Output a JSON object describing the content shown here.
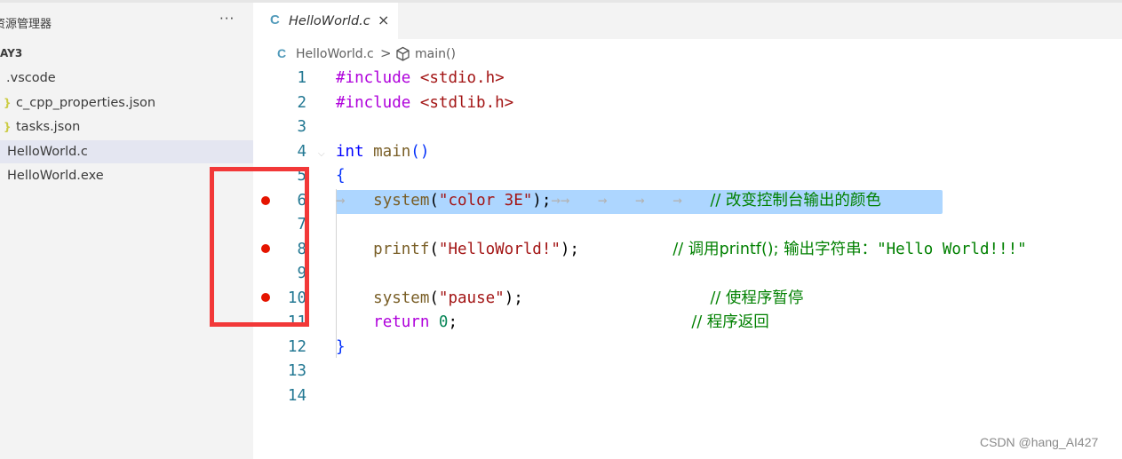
{
  "sidebar": {
    "title": "资源管理器",
    "more": "···",
    "project": "AY3",
    "items": [
      {
        "label": ".vscode",
        "icon": ""
      },
      {
        "label": "c_cpp_properties.json",
        "icon": "}"
      },
      {
        "label": "tasks.json",
        "icon": "}"
      },
      {
        "label": "HelloWorld.c",
        "icon": ""
      },
      {
        "label": "HelloWorld.exe",
        "icon": ""
      }
    ]
  },
  "editor": {
    "tab": {
      "icon": "C",
      "label": "HelloWorld.c",
      "close": "×"
    },
    "breadcrumb": {
      "icon": "C",
      "file": "HelloWorld.c",
      "sep": ">",
      "method_icon": "⬡",
      "method": "main()"
    },
    "line_numbers": [
      "1",
      "2",
      "3",
      "4",
      "5",
      "6",
      "7",
      "8",
      "9",
      "10",
      "11",
      "12",
      "13",
      "14"
    ],
    "code": {
      "l1_pp": "#include",
      "l1_hdr": " <stdio.h>",
      "l2_pp": "#include",
      "l2_hdr": " <stdlib.h>",
      "l4_type": "int",
      "l4_fn": " main",
      "l4_paren": "()",
      "l5": "{",
      "l6_fn": "system",
      "l6_open": "(",
      "l6_str": "\"color 3E\"",
      "l6_close": ");",
      "l6_cmt": "// 改变控制台输出的颜色",
      "l8_fn": "printf",
      "l8_open": "(",
      "l8_str": "\"HelloWorld!\"",
      "l8_close": ");",
      "l8_cmt_a": "// 调用printf(); 输出字符串：",
      "l8_cmt_b": "\"Hello World!!!\"",
      "l10_fn": "system",
      "l10_open": "(",
      "l10_str": "\"pause\"",
      "l10_close": ");",
      "l10_cmt": "// 使程序暂停",
      "l11_kw": "return",
      "l11_num": "0",
      "l11_end": ";",
      "l11_cmt": "// 程序返回",
      "l12": "}"
    }
  },
  "watermark": "CSDN @hang_AI427"
}
